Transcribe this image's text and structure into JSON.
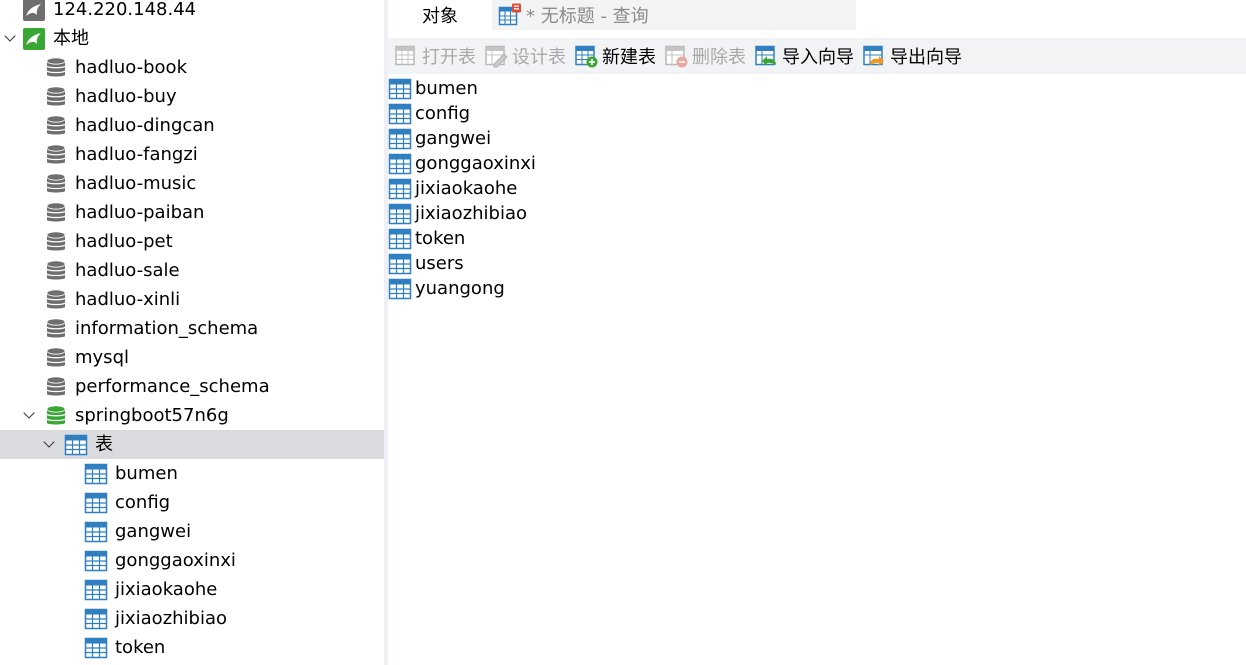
{
  "sidebar": {
    "connection": "124.220.148.44",
    "local": "本地",
    "databases": [
      {
        "name": "hadluo-book"
      },
      {
        "name": "hadluo-buy"
      },
      {
        "name": "hadluo-dingcan"
      },
      {
        "name": "hadluo-fangzi"
      },
      {
        "name": "hadluo-music"
      },
      {
        "name": "hadluo-paiban"
      },
      {
        "name": "hadluo-pet"
      },
      {
        "name": "hadluo-sale"
      },
      {
        "name": "hadluo-xinli"
      },
      {
        "name": "information_schema"
      },
      {
        "name": "mysql"
      },
      {
        "name": "performance_schema"
      },
      {
        "name": "springboot57n6g"
      }
    ],
    "tables_node": "表",
    "tables": [
      {
        "name": "bumen"
      },
      {
        "name": "config"
      },
      {
        "name": "gangwei"
      },
      {
        "name": "gonggaoxinxi"
      },
      {
        "name": "jixiaokaohe"
      },
      {
        "name": "jixiaozhibiao"
      },
      {
        "name": "token"
      }
    ]
  },
  "tabs": {
    "objects": "对象",
    "query": "* 无标题 - 查询"
  },
  "toolbar": {
    "open_table": "打开表",
    "design_table": "设计表",
    "new_table": "新建表",
    "delete_table": "删除表",
    "import_wizard": "导入向导",
    "export_wizard": "导出向导"
  },
  "objects": [
    {
      "name": "bumen"
    },
    {
      "name": "config"
    },
    {
      "name": "gangwei"
    },
    {
      "name": "gonggaoxinxi"
    },
    {
      "name": "jixiaokaohe"
    },
    {
      "name": "jixiaozhibiao"
    },
    {
      "name": "token"
    },
    {
      "name": "users"
    },
    {
      "name": "yuangong"
    }
  ],
  "colors": {
    "selected_row": "#d9dbdf",
    "toolbar_bg": "#f2f3f5",
    "db_green": "#3aa735",
    "db_gray": "#6e6e6e",
    "table_blue": "#2f7fc1",
    "disabled_text": "#a9a9a9"
  }
}
